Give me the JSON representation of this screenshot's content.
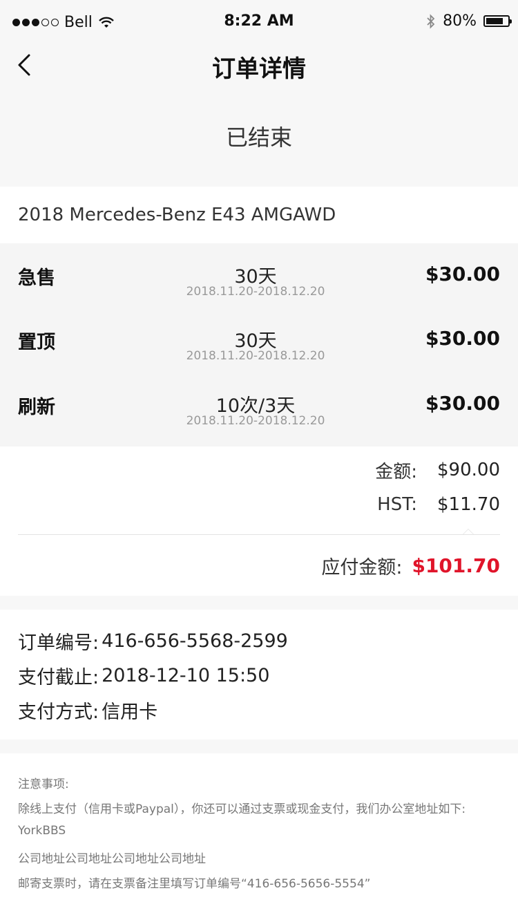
{
  "status_bar": {
    "carrier": "Bell",
    "time": "8:22 AM",
    "battery": "80%",
    "battery_level": 0.8,
    "signal_bars_filled": 3,
    "signal_bars_total": 5
  },
  "navbar": {
    "title": "订单详情"
  },
  "order_status": "已结束",
  "vehicle": "2018 Mercedes-Benz E43 AMGAWD",
  "services": [
    {
      "name": "急售",
      "duration": "30天",
      "range": "2018.11.20-2018.12.20",
      "price": "$30.00"
    },
    {
      "name": "置顶",
      "duration": "30天",
      "range": "2018.11.20-2018.12.20",
      "price": "$30.00"
    },
    {
      "name": "刷新",
      "duration": "10次/3天",
      "range": "2018.11.20-2018.12.20",
      "price": "$30.00"
    }
  ],
  "totals": {
    "amount_label": "金额:",
    "amount_value": "$90.00",
    "hst_label": "HST:",
    "hst_value": "$11.70",
    "due_label": "应付金额:",
    "due_value": "$101.70"
  },
  "order_info": {
    "number_label": "订单编号:",
    "number_value": "416-656-5568-2599",
    "deadline_label": "支付截止:",
    "deadline_value": "2018-12-10 15:50",
    "method_label": "支付方式:",
    "method_value": "信用卡"
  },
  "notes": [
    "注意事项:",
    "除线上支付（信用卡或Paypal），你还可以通过支票或现金支付，我们办公室地址如下:",
    "YorkBBS",
    "公司地址公司地址公司地址公司地址",
    "邮寄支票时，请在支票备注里填写订单编号“416-656-5656-5554”"
  ],
  "colors": {
    "accent_red": "#e0142a",
    "background": "#f7f7f7"
  }
}
